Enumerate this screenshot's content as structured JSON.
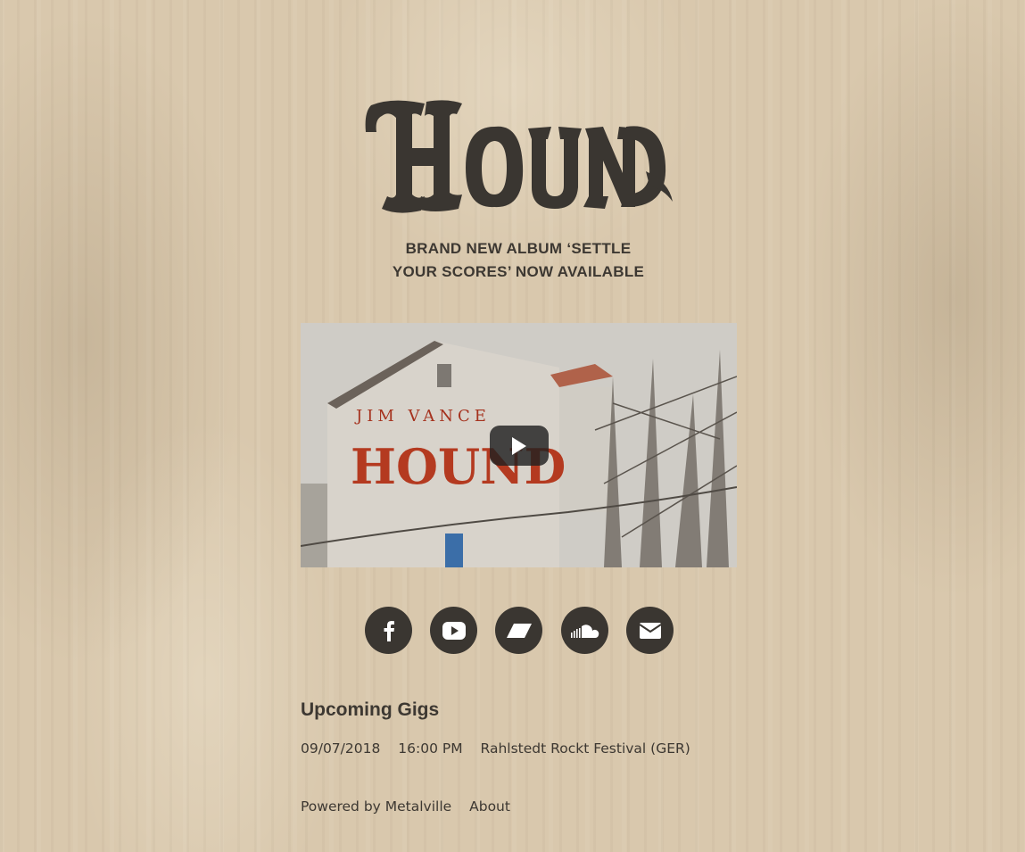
{
  "brand": {
    "logo_text": "HOUND"
  },
  "headline": {
    "line1": "BRAND NEW ALBUM ‘SETTLE",
    "line2": "YOUR SCORES’ NOW AVAILABLE"
  },
  "video": {
    "thumbnail_text_top": "JIM VANCE",
    "thumbnail_text_main": "HOUND",
    "play_icon": "play-icon"
  },
  "socials": [
    {
      "name": "facebook",
      "icon": "facebook-icon"
    },
    {
      "name": "youtube",
      "icon": "youtube-icon"
    },
    {
      "name": "bandcamp",
      "icon": "bandcamp-icon"
    },
    {
      "name": "soundcloud",
      "icon": "soundcloud-icon"
    },
    {
      "name": "email",
      "icon": "envelope-icon"
    }
  ],
  "gigs": {
    "title": "Upcoming Gigs",
    "items": [
      {
        "date": "09/07/2018",
        "time": "16:00 PM",
        "event": "Rahlstedt Rockt Festival (GER)"
      }
    ]
  },
  "footer": {
    "powered_by": "Powered by Metalville",
    "about": "About"
  },
  "colors": {
    "background": "#d9c8ad",
    "ink": "#3a3631",
    "play_button": "#212121"
  }
}
